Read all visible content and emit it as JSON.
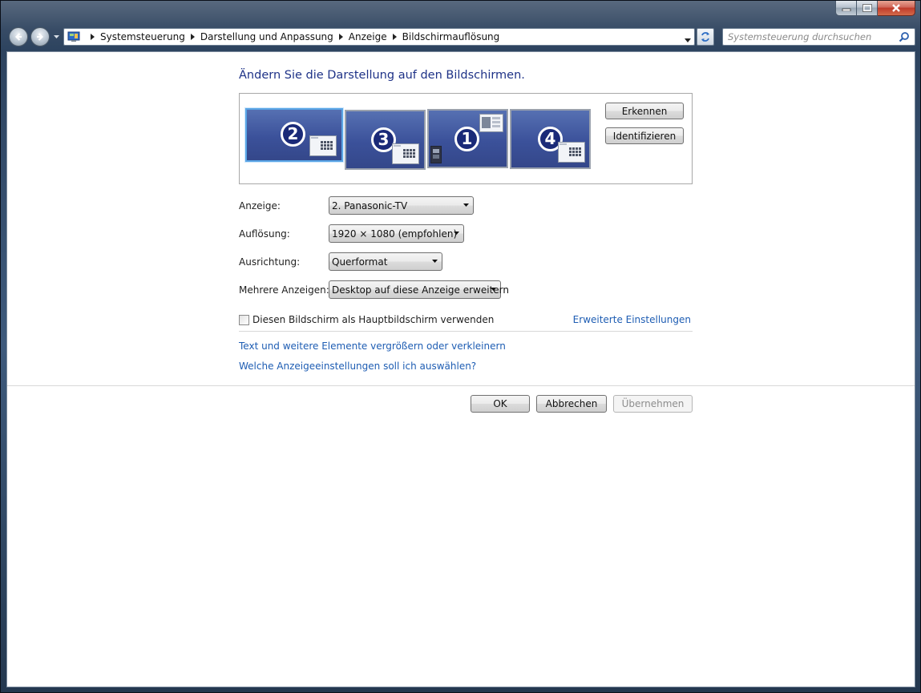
{
  "breadcrumb": [
    "Systemsteuerung",
    "Darstellung und Anpassung",
    "Anzeige",
    "Bildschirmauflösung"
  ],
  "search": {
    "placeholder": "Systemsteuerung durchsuchen"
  },
  "page": {
    "title": "Ändern Sie die Darstellung auf den Bildschirmen."
  },
  "monitors": [
    {
      "number": "2",
      "selected": true
    },
    {
      "number": "3",
      "selected": false
    },
    {
      "number": "1",
      "selected": false
    },
    {
      "number": "4",
      "selected": false
    }
  ],
  "buttons": {
    "detect": "Erkennen",
    "identify": "Identifizieren",
    "ok": "OK",
    "cancel": "Abbrechen",
    "apply": "Übernehmen"
  },
  "fields": {
    "display": {
      "label": "Anzeige:",
      "value": "2. Panasonic-TV"
    },
    "resolution": {
      "label": "Auflösung:",
      "value": "1920 × 1080 (empfohlen)"
    },
    "orientation": {
      "label": "Ausrichtung:",
      "value": "Querformat"
    },
    "multiple": {
      "label": "Mehrere Anzeigen:",
      "value": "Desktop auf diese Anzeige erweitern"
    }
  },
  "checkbox": {
    "label": "Diesen Bildschirm als Hauptbildschirm verwenden",
    "checked": false
  },
  "links": {
    "advanced": "Erweiterte Einstellungen",
    "text_size": "Text und weitere Elemente vergrößern oder verkleinern",
    "which_settings": "Welche Anzeigeeinstellungen soll ich auswählen?"
  },
  "colors": {
    "title_blue": "#1e3287",
    "link_blue": "#1e5db3",
    "monitor_blue": "#3b519a"
  }
}
